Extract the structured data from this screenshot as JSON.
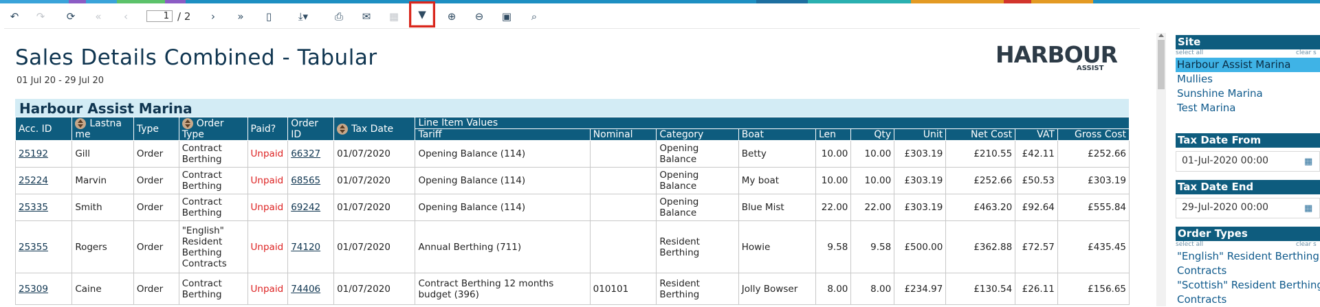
{
  "toolbar": {
    "current_page": "1",
    "total_pages": "/ 2",
    "icons": {
      "back": "↶",
      "forward": "↷",
      "refresh": "⟳",
      "first": "«",
      "prev": "‹",
      "next": "›",
      "last": "»",
      "document": "▯",
      "export": "⤓▾",
      "print": "⎙",
      "email": "✉",
      "copy": "▦",
      "filter": "▼",
      "zoom_in": "⊕",
      "zoom_out": "⊖",
      "screen": "▣",
      "search": "⌕"
    }
  },
  "report": {
    "title": "Sales Details Combined - Tabular",
    "date_range": "01 Jul 20 - 29 Jul 20",
    "logo_main": "HARBOUR",
    "logo_sub": "ASSIST",
    "site_name": "Harbour Assist Marina"
  },
  "columns": {
    "acc_id": "Acc. ID",
    "lastname": "Lastna me",
    "type": "Type",
    "order_type": "Order Type",
    "paid": "Paid?",
    "order_id": "Order ID",
    "tax_date": "Tax Date",
    "line_item_values": "Line Item Values",
    "tariff": "Tariff",
    "nominal": "Nominal",
    "category": "Category",
    "boat": "Boat",
    "len": "Len",
    "qty": "Qty",
    "unit": "Unit",
    "net_cost": "Net Cost",
    "vat": "VAT",
    "gross_cost": "Gross Cost"
  },
  "rows": [
    {
      "acc_id": "25192",
      "lastname": "Gill",
      "type": "Order",
      "order_type": "Contract Berthing",
      "paid": "Unpaid",
      "order_id": "66327",
      "tax_date": "01/07/2020",
      "tariff": "Opening Balance (114)",
      "nominal": "",
      "category": "Opening Balance",
      "boat": "Betty",
      "len": "10.00",
      "qty": "10.00",
      "unit": "£303.19",
      "net_cost": "£210.55",
      "vat": "£42.11",
      "gross_cost": "£252.66"
    },
    {
      "acc_id": "25224",
      "lastname": "Marvin",
      "type": "Order",
      "order_type": "Contract Berthing",
      "paid": "Unpaid",
      "order_id": "68565",
      "tax_date": "01/07/2020",
      "tariff": "Opening Balance (114)",
      "nominal": "",
      "category": "Opening Balance",
      "boat": "My boat",
      "len": "10.00",
      "qty": "10.00",
      "unit": "£303.19",
      "net_cost": "£252.66",
      "vat": "£50.53",
      "gross_cost": "£303.19"
    },
    {
      "acc_id": "25335",
      "lastname": "Smith",
      "type": "Order",
      "order_type": "Contract Berthing",
      "paid": "Unpaid",
      "order_id": "69242",
      "tax_date": "01/07/2020",
      "tariff": "Opening Balance (114)",
      "nominal": "",
      "category": "Opening Balance",
      "boat": "Blue Mist",
      "len": "22.00",
      "qty": "22.00",
      "unit": "£303.19",
      "net_cost": "£463.20",
      "vat": "£92.64",
      "gross_cost": "£555.84"
    },
    {
      "acc_id": "25355",
      "lastname": "Rogers",
      "type": "Order",
      "order_type": "\"English\" Resident Berthing Contracts",
      "paid": "Unpaid",
      "order_id": "74120",
      "tax_date": "01/07/2020",
      "tariff": "Annual Berthing (711)",
      "nominal": "",
      "category": "Resident Berthing",
      "boat": "Howie",
      "len": "9.58",
      "qty": "9.58",
      "unit": "£500.00",
      "net_cost": "£362.88",
      "vat": "£72.57",
      "gross_cost": "£435.45"
    },
    {
      "acc_id": "25309",
      "lastname": "Caine",
      "type": "Order",
      "order_type": "Contract Berthing",
      "paid": "Unpaid",
      "order_id": "74406",
      "tax_date": "01/07/2020",
      "tariff": "Contract Berthing 12 months budget (396)",
      "nominal": "010101",
      "category": "Resident Berthing",
      "boat": "Jolly Bowser",
      "len": "8.00",
      "qty": "8.00",
      "unit": "£234.97",
      "net_cost": "£130.54",
      "vat": "£26.11",
      "gross_cost": "£156.65"
    }
  ],
  "filters": {
    "site": {
      "header": "Site",
      "select_all": "select all",
      "clear": "clear s",
      "options": [
        "Harbour Assist Marina",
        "Mullies",
        "Sunshine Marina",
        "Test Marina"
      ],
      "selected": "Harbour Assist Marina"
    },
    "tax_date_from": {
      "header": "Tax Date From",
      "value": "01-Jul-2020 00:00"
    },
    "tax_date_end": {
      "header": "Tax Date End",
      "value": "29-Jul-2020 00:00"
    },
    "order_types": {
      "header": "Order Types",
      "select_all": "select all",
      "clear": "clear s",
      "options": [
        "\"English\" Resident Berthing",
        "Contracts",
        "\"Scottish\" Resident Berthing",
        "Contracts"
      ]
    }
  }
}
